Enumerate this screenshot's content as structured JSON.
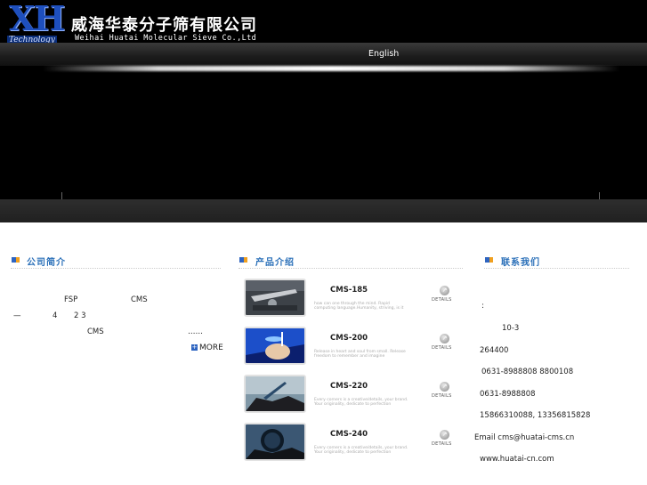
{
  "header": {
    "logo_text": "XH",
    "logo_sub": "Technology",
    "company_cn": "威海华泰分子筛有限公司",
    "company_en": "Weihai Huatai Molecular Sieve Co.,Ltd"
  },
  "nav": {
    "english": "English"
  },
  "about": {
    "title": "公司简介",
    "lines": [
      {
        "a": "FSP",
        "b": "CMS"
      },
      {
        "a": "—",
        "b": "4",
        "c": "2 3"
      },
      {
        "a": "CMS",
        "b": "……"
      }
    ],
    "more": "MORE"
  },
  "products": {
    "title": "产品介绍",
    "items": [
      {
        "name": "CMS-185",
        "desc": "how can one through the mind. Rapid computing language.Humanity, striving, is it",
        "details": "DETAILS"
      },
      {
        "name": "CMS-200",
        "desc": "Release in heart and soul from small. Release freedom to remember and imagine",
        "details": "DETAILS"
      },
      {
        "name": "CMS-220",
        "desc": "Every corners is a creative/details, your brand. Your originality, dedicate to perfection",
        "details": "DETAILS"
      },
      {
        "name": "CMS-240",
        "desc": "Every corners is a creative/details, your brand. Your originality, dedicate to perfection",
        "details": "DETAILS"
      }
    ]
  },
  "contact": {
    "title": "联系我们",
    "colon": ":",
    "address": "10-3",
    "postcode": "264400",
    "tel": "0631-8988808 8800108",
    "fax": "0631-8988808",
    "mobile": "15866310088, 13356815828",
    "email": "Email cms@huatai-cms.cn",
    "web": "www.huatai-cn.com"
  },
  "colors": {
    "accent_blue": "#2a6fb8",
    "square_orange": "#f0a020",
    "logo_blue": "#1e4fbd"
  }
}
